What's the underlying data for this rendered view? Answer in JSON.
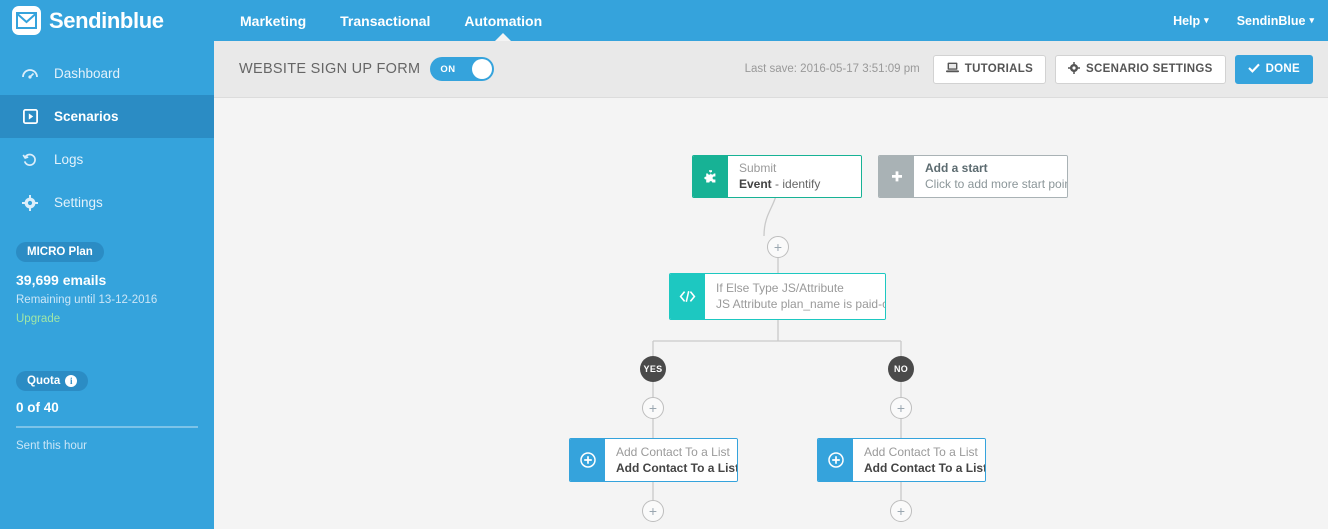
{
  "brand": {
    "name": "Sendinblue",
    "icon": "envelope-icon"
  },
  "sidebar": {
    "items": [
      {
        "label": "Dashboard",
        "icon": "dashboard-icon",
        "active": false
      },
      {
        "label": "Scenarios",
        "icon": "scenarios-icon",
        "active": true
      },
      {
        "label": "Logs",
        "icon": "logs-history-icon",
        "active": false
      },
      {
        "label": "Settings",
        "icon": "gear-icon",
        "active": false
      }
    ],
    "plan": {
      "badge": "MICRO Plan",
      "emails": "39,699 emails",
      "remaining": "Remaining until 13-12-2016",
      "upgrade": "Upgrade"
    },
    "quota": {
      "badge": "Quota",
      "info_icon": "info-icon",
      "value": "0 of 40",
      "caption": "Sent this hour"
    }
  },
  "topnav": {
    "items": [
      {
        "label": "Marketing",
        "active": false
      },
      {
        "label": "Transactional",
        "active": false
      },
      {
        "label": "Automation",
        "active": true
      }
    ],
    "help": "Help",
    "account": "SendinBlue"
  },
  "subheader": {
    "scenario_name": "WEBSITE SIGN UP FORM",
    "toggle_state": "ON",
    "last_save": "Last save: 2016-05-17 3:51:09 pm",
    "tutorials_button": "TUTORIALS",
    "settings_button": "SCENARIO SETTINGS",
    "done_button": "DONE"
  },
  "colors": {
    "brand_blue": "#35a3dc",
    "sidebar_active": "#2b8cc4",
    "green_node": "#17b295",
    "teal_node": "#1dc8c1",
    "blue_node": "#35a3dc",
    "gray_node": "#a9b2b5",
    "canvas": "#f4f4f4"
  },
  "flow": {
    "nodes": [
      {
        "id": "submit",
        "icon": "puzzle-piece-icon",
        "title": "Submit",
        "subtitle_bold": "Event",
        "subtitle_rest": " - identify",
        "color": "green"
      },
      {
        "id": "add-start",
        "icon": "plus-icon",
        "title": "Add a start",
        "subtitle_bold": "",
        "subtitle_rest": "Click to add more start points",
        "color": "gray"
      },
      {
        "id": "if-else",
        "icon": "code-icon",
        "title": "If Else Type JS/Attribute",
        "subtitle_bold": "",
        "subtitle_rest": "JS Attribute plan_name is paid-client",
        "color": "teal"
      },
      {
        "id": "add-yes",
        "icon": "plus-circle-icon",
        "title": "Add Contact To a List",
        "subtitle_bold": "Add Contact To a List - ...",
        "subtitle_rest": "",
        "color": "blue"
      },
      {
        "id": "add-no",
        "icon": "plus-circle-icon",
        "title": "Add Contact To a List",
        "subtitle_bold": "Add Contact To a List - i...",
        "subtitle_rest": "",
        "color": "blue"
      }
    ],
    "branches": [
      {
        "label": "YES"
      },
      {
        "label": "NO"
      }
    ],
    "plus_buttons": [
      "+",
      "+",
      "+",
      "+",
      "+"
    ]
  }
}
